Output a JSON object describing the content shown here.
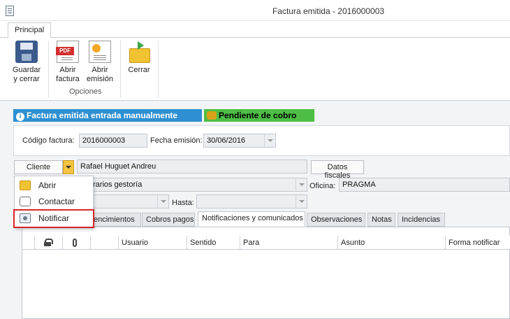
{
  "window": {
    "title": "Factura emitida - 2016000003"
  },
  "ribbon": {
    "tab": "Principal",
    "buttons": {
      "save": "Guardar y cerrar",
      "open_invoice": "Abrir factura",
      "open_issue": "Abrir emisión",
      "close": "Cerrar"
    },
    "group_label": "Opciones"
  },
  "banners": {
    "info": "Factura emitida entrada manualmente",
    "status": "Pendiente de cobro"
  },
  "form": {
    "codigo_label": "Código factura:",
    "codigo_value": "2016000003",
    "fecha_label": "Fecha emisión:",
    "fecha_value": "30/06/2016",
    "cliente_button": "Cliente",
    "cliente_value": "Rafael Huguet Andreu",
    "datos_fiscales_button": "Datos fiscales",
    "gestoria_value": "rarios gestoría",
    "oficina_label": "Oficina:",
    "oficina_value": "PRAGMA",
    "hasta_label": "Hasta:"
  },
  "tabs": [
    {
      "label": "encimientos"
    },
    {
      "label": "Cobros pagos"
    },
    {
      "label": "Notificaciones y comunicados"
    },
    {
      "label": "Observaciones"
    },
    {
      "label": "Notas"
    },
    {
      "label": "Incidencias"
    }
  ],
  "grid": {
    "columns": [
      "Usuario",
      "Sentido",
      "Para",
      "Asunto",
      "Forma notificar"
    ]
  },
  "context_menu": {
    "items": [
      {
        "label": "Abrir",
        "icon": "folder-icon"
      },
      {
        "label": "Contactar",
        "icon": "chat-icon"
      },
      {
        "label": "Notificar",
        "icon": "notify-icon"
      }
    ]
  },
  "colors": {
    "info_banner": "#2e8fd2",
    "status_banner": "#4dbe45",
    "highlight": "#d9262c"
  }
}
